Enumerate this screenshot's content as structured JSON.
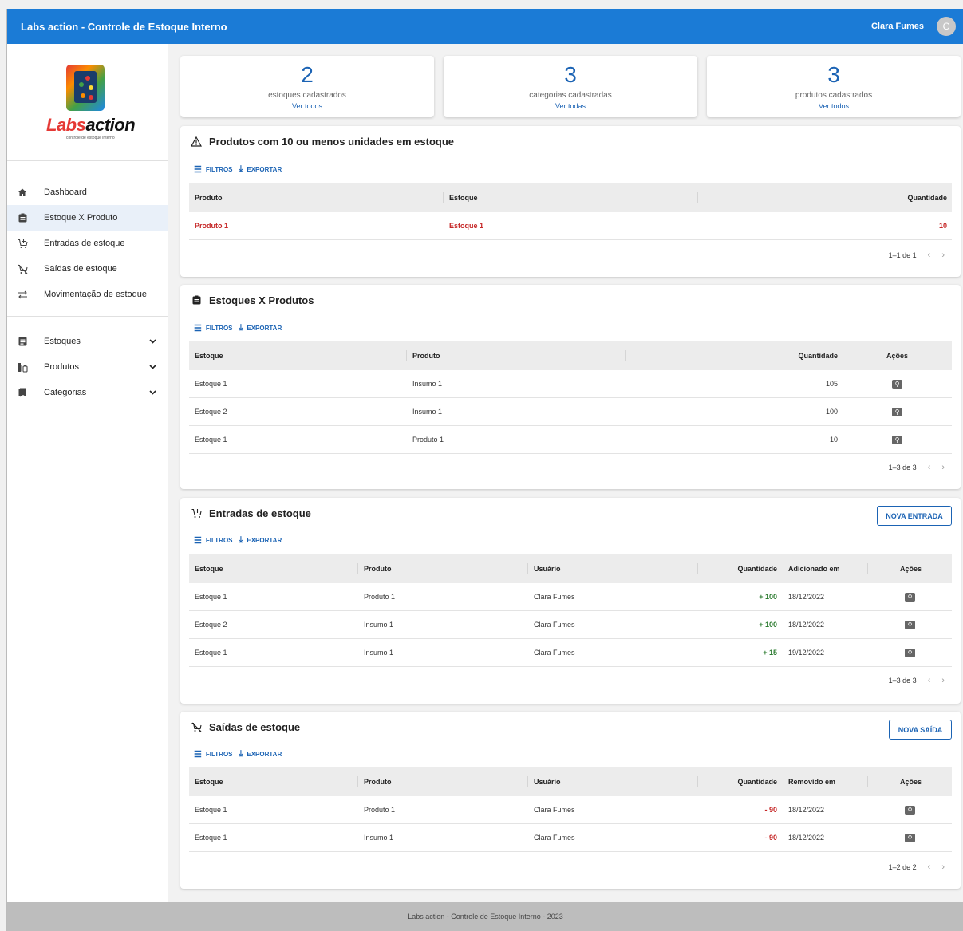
{
  "app": {
    "title": "Labs action - Controle de Estoque Interno",
    "user_name": "Clara Fumes",
    "avatar_initial": "C",
    "brand_color": "#1b7bd6"
  },
  "logo": {
    "word_a": "Labs",
    "word_b": "action",
    "tagline": "controle de estoque interno"
  },
  "sidebar": {
    "items": [
      {
        "label": "Dashboard",
        "icon": "home-icon"
      },
      {
        "label": "Estoque X Produto",
        "icon": "clipboard-icon",
        "active": true
      },
      {
        "label": "Entradas de estoque",
        "icon": "cart-add-icon"
      },
      {
        "label": "Saídas de estoque",
        "icon": "cart-remove-icon"
      },
      {
        "label": "Movimentação de estoque",
        "icon": "swap-icon"
      }
    ],
    "groups": [
      {
        "label": "Estoques",
        "icon": "list-icon"
      },
      {
        "label": "Produtos",
        "icon": "products-icon"
      },
      {
        "label": "Categorias",
        "icon": "bookmark-icon"
      }
    ]
  },
  "stats": [
    {
      "value": "2",
      "label": "estoques cadastrados",
      "link": "Ver todos"
    },
    {
      "value": "3",
      "label": "categorias cadastradas",
      "link": "Ver todas"
    },
    {
      "value": "3",
      "label": "produtos cadastrados",
      "link": "Ver todos"
    }
  ],
  "toolbar": {
    "filters": "FILTROS",
    "export": "EXPORTAR"
  },
  "low_stock": {
    "title": "Produtos com 10 ou menos unidades em estoque",
    "headers": [
      "Produto",
      "Estoque",
      "Quantidade"
    ],
    "rows": [
      {
        "produto": "Produto 1",
        "estoque": "Estoque 1",
        "quantidade": "10"
      }
    ],
    "pagination": "1–1 de 1"
  },
  "stock_products": {
    "title": "Estoques X Produtos",
    "headers": [
      "Estoque",
      "Produto",
      "Quantidade",
      "Ações"
    ],
    "rows": [
      {
        "estoque": "Estoque 1",
        "produto": "Insumo 1",
        "quantidade": "105"
      },
      {
        "estoque": "Estoque 2",
        "produto": "Insumo 1",
        "quantidade": "100"
      },
      {
        "estoque": "Estoque 1",
        "produto": "Produto 1",
        "quantidade": "10"
      }
    ],
    "pagination": "1–3 de 3"
  },
  "entries": {
    "title": "Entradas de estoque",
    "button": "NOVA ENTRADA",
    "headers": [
      "Estoque",
      "Produto",
      "Usuário",
      "Quantidade",
      "Adicionado em",
      "Ações"
    ],
    "rows": [
      {
        "estoque": "Estoque 1",
        "produto": "Produto 1",
        "usuario": "Clara Fumes",
        "quantidade": "+ 100",
        "data": "18/12/2022"
      },
      {
        "estoque": "Estoque 2",
        "produto": "Insumo 1",
        "usuario": "Clara Fumes",
        "quantidade": "+ 100",
        "data": "18/12/2022"
      },
      {
        "estoque": "Estoque 1",
        "produto": "Insumo 1",
        "usuario": "Clara Fumes",
        "quantidade": "+ 15",
        "data": "19/12/2022"
      }
    ],
    "pagination": "1–3 de 3"
  },
  "exits": {
    "title": "Saídas de estoque",
    "button": "NOVA SAÍDA",
    "headers": [
      "Estoque",
      "Produto",
      "Usuário",
      "Quantidade",
      "Removido em",
      "Ações"
    ],
    "rows": [
      {
        "estoque": "Estoque 1",
        "produto": "Produto 1",
        "usuario": "Clara Fumes",
        "quantidade": "- 90",
        "data": "18/12/2022"
      },
      {
        "estoque": "Estoque 1",
        "produto": "Insumo 1",
        "usuario": "Clara Fumes",
        "quantidade": "- 90",
        "data": "18/12/2022"
      }
    ],
    "pagination": "1–2 de 2"
  },
  "pager_icons": {
    "prev": "‹",
    "next": "›"
  },
  "footer": "Labs action - Controle de Estoque Interno - 2023"
}
